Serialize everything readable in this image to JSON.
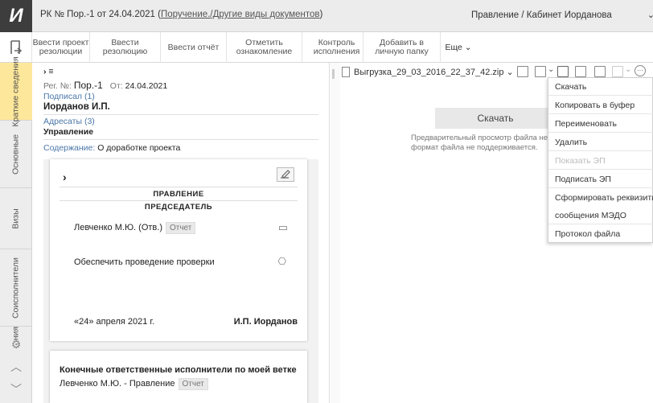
{
  "app": {
    "logo": "И",
    "title_prefix": "РК № Пор.-1 от 24.04.2021 (",
    "title_link": "Поручение./Другие виды документов",
    "title_suffix": ")",
    "user_context": "Правление / Кабинет Иорданова",
    "user_context_chevron": "⌄"
  },
  "toolbar": {
    "buttons": [
      {
        "line1": "Ввести проект",
        "line2": "резолюции"
      },
      {
        "line1": "Ввести",
        "line2": "резолюцию"
      },
      {
        "line1": "Ввести отчёт",
        "line2": ""
      },
      {
        "line1": "Отметить",
        "line2": "ознакомление"
      },
      {
        "line1": "Контроль",
        "line2": "исполнения"
      },
      {
        "line1": "Добавить в",
        "line2": "личную папку"
      }
    ],
    "more": "Еще ⌄"
  },
  "vnav": {
    "tabs": [
      "Краткие сведения",
      "Основные",
      "Визы",
      "Соисполнители",
      "...ния"
    ]
  },
  "doc": {
    "toggle": "› ≡",
    "reg_label": "Рег. №:",
    "reg_value": "Пор.-1",
    "date_label": "От:",
    "date_value": "24.04.2021",
    "signed_label": "Подписал (1)",
    "signer": "Иорданов И.П.",
    "addressees_label": "Адресаты (3)",
    "addressee": "Управление",
    "content_label": "Содержание:",
    "content_value": "О доработке проекта"
  },
  "card": {
    "expand": "›",
    "org": "ПРАВЛЕНИЕ",
    "role": "ПРЕДСЕДАТЕЛЬ",
    "executor": "Левченко М.Ю. (Отв.)",
    "executor_badge": "Отчет",
    "task": "Обеспечить проведение проверки",
    "date": "«24» апреля 2021 г.",
    "signature": "И.П. Иорданов"
  },
  "card2": {
    "heading": "Конечные ответственные исполнители по моей ветке",
    "executor": "Левченко М.Ю. - Правление",
    "badge": "Отчет"
  },
  "file": {
    "name": "Выгрузка_29_03_2016_22_37_42.zip ⌄",
    "download": "Скачать",
    "note_line1": "Предварительный просмотр файла нев",
    "note_line2": "формат файла не поддерживается."
  },
  "menu": {
    "items": [
      {
        "label": "Скачать",
        "disabled": false
      },
      {
        "label": "Копировать в буфер",
        "disabled": false
      },
      {
        "label": "Переименовать",
        "disabled": false
      },
      {
        "label": "Удалить",
        "disabled": false
      },
      {
        "label": "Показать ЭП",
        "disabled": true
      },
      {
        "label": "Подписать ЭП",
        "disabled": false
      },
      {
        "label": "Сформировать реквизиты",
        "disabled": false
      },
      {
        "label": "сообщения МЭДО",
        "disabled": false
      },
      {
        "label": "Протокол файла",
        "disabled": false
      }
    ]
  }
}
